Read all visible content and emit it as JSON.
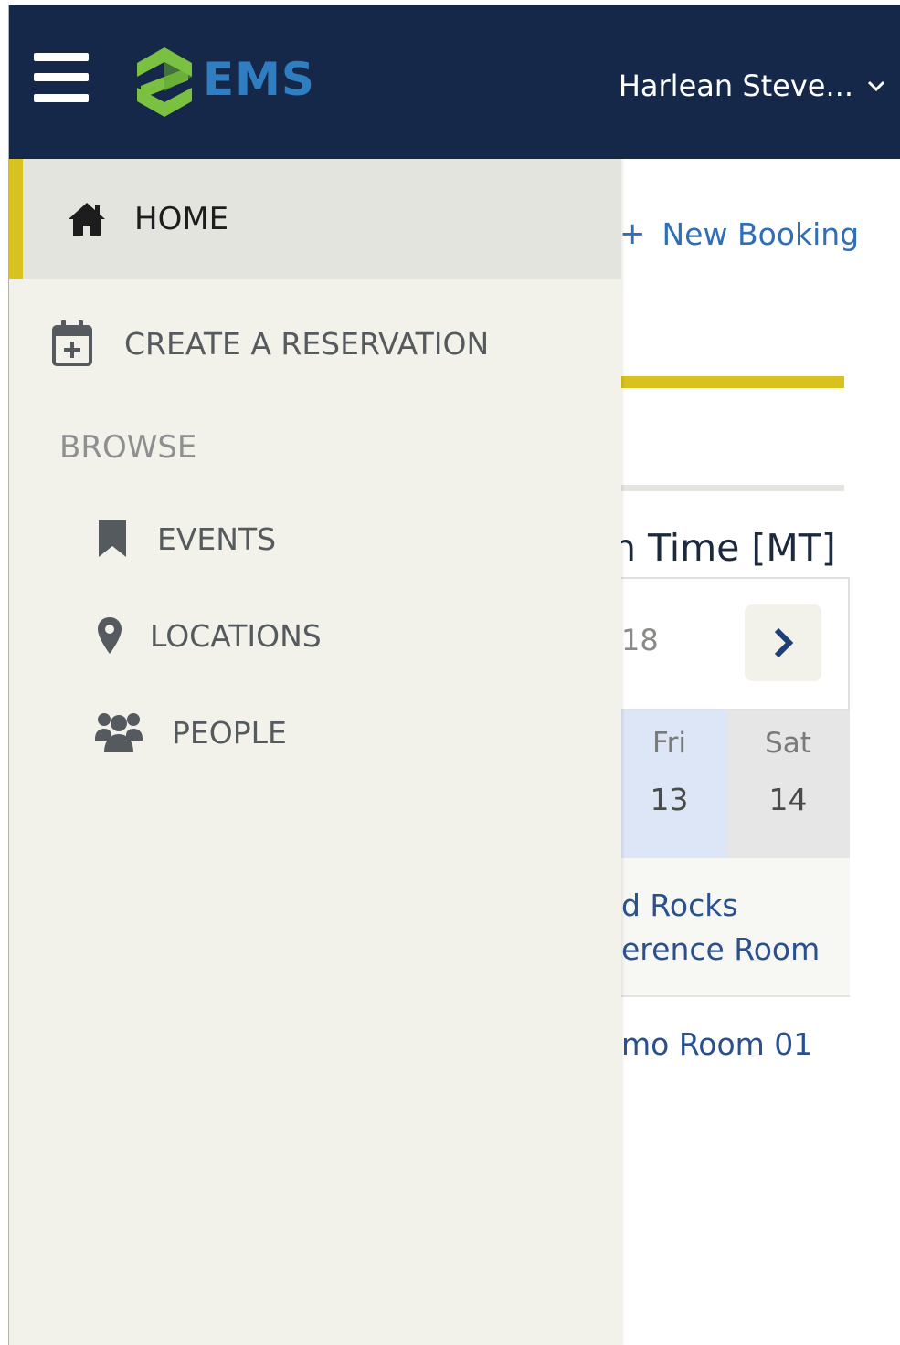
{
  "header": {
    "brand": "EMS",
    "user_name": "Harlean Steve...",
    "colors": {
      "background": "#15284a",
      "logo_green": "#7ac142",
      "logo_blue": "#2f7ec1"
    },
    "icons": {
      "menu": "hamburger-menu-icon",
      "dropdown": "chevron-down-icon"
    }
  },
  "drawer": {
    "home_label": "HOME",
    "create_label": "CREATE A RESERVATION",
    "browse_heading": "BROWSE",
    "browse_items": [
      {
        "label": "EVENTS",
        "icon": "bookmark-icon"
      },
      {
        "label": "LOCATIONS",
        "icon": "map-pin-icon"
      },
      {
        "label": "PEOPLE",
        "icon": "people-icon"
      }
    ],
    "colors": {
      "background": "#f2f1ea",
      "active_bg": "#e4e4df",
      "accent": "#d7c21f"
    }
  },
  "background": {
    "new_booking_label": "New Booking",
    "timezone_fragment": "n Time [MT]",
    "date_fragment": "18",
    "days": [
      {
        "name": "Fri",
        "num": "13"
      },
      {
        "name": "Sat",
        "num": "14"
      }
    ],
    "rooms": [
      {
        "line1": "d Rocks",
        "line2": "erence Room"
      },
      {
        "line1": "mo Room 01"
      }
    ],
    "colors": {
      "link": "#2f6fb8",
      "room_link": "#2b5090"
    }
  }
}
